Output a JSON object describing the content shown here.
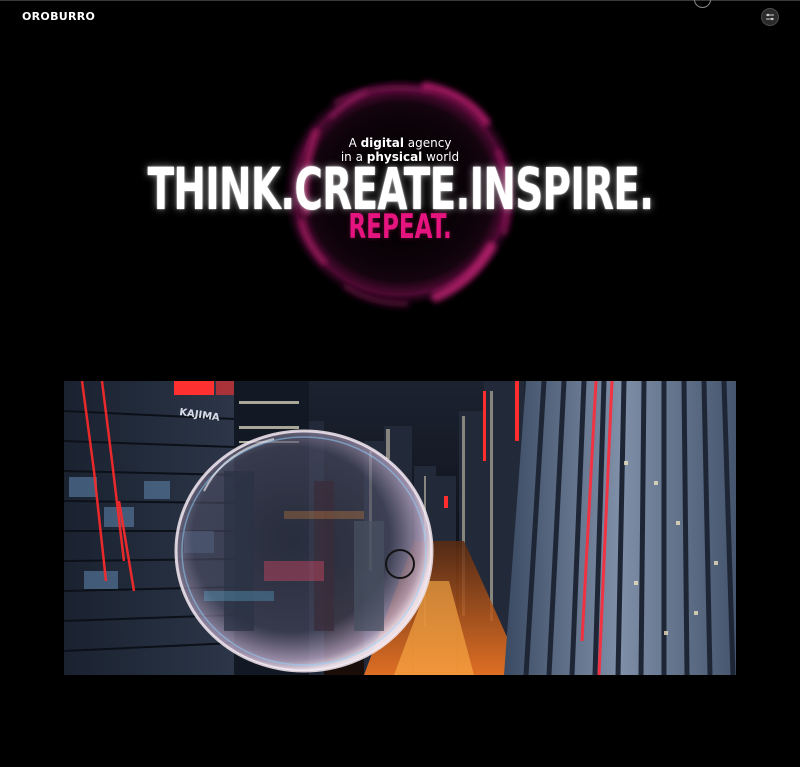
{
  "header": {
    "logo_text": "OROBURRO",
    "menu_icon": "sliders-icon"
  },
  "hero": {
    "tagline_line1_pre": "A ",
    "tagline_line1_bold": "digital",
    "tagline_line1_post": " agency",
    "tagline_line2_pre": "in a ",
    "tagline_line2_bold": "physical",
    "tagline_line2_post": " world",
    "headline": "THINK.CREATE.INSPIRE.",
    "subline": "REPEAT."
  },
  "media": {
    "building_sign": "KAJIMA",
    "description_icon": "city-night-glass-sphere-image"
  },
  "colors": {
    "background": "#000000",
    "accent": "#e6147e",
    "text": "#ffffff"
  }
}
